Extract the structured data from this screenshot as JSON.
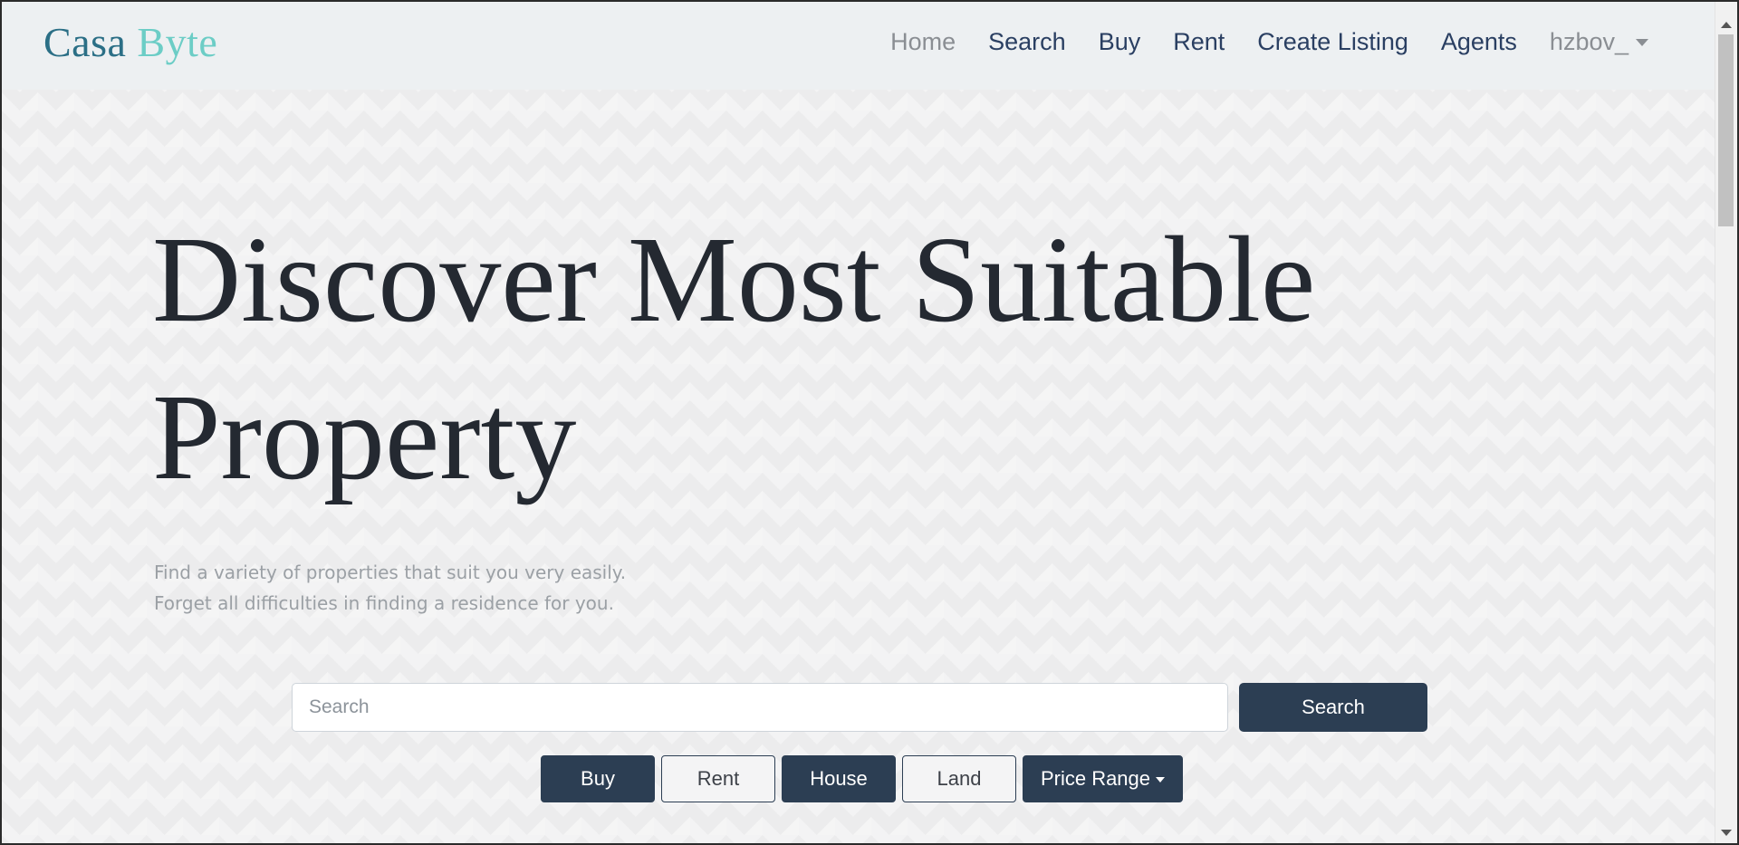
{
  "brand": {
    "part1": "Casa",
    "part2": "Byte"
  },
  "nav": {
    "items": [
      {
        "label": "Home",
        "active": true
      },
      {
        "label": "Search"
      },
      {
        "label": "Buy"
      },
      {
        "label": "Rent"
      },
      {
        "label": "Create Listing"
      },
      {
        "label": "Agents"
      }
    ],
    "user": "hzbov_"
  },
  "hero": {
    "title_line1": "Discover Most Suitable",
    "title_line2": "Property",
    "subtitle_line1": "Find a variety of properties that suit you very easily.",
    "subtitle_line2": "Forget all difficulties in finding a residence for you."
  },
  "search": {
    "placeholder": "Search",
    "value": "",
    "button_label": "Search"
  },
  "filters": {
    "buy": "Buy",
    "rent": "Rent",
    "house": "House",
    "land": "Land",
    "price_range": "Price Range"
  },
  "colors": {
    "primary_dark": "#2c3e53",
    "brand_teal_dark": "#2b6f86",
    "brand_teal_light": "#6ccdc6",
    "nav_link": "#2a3f62",
    "muted": "#8a8e93"
  }
}
